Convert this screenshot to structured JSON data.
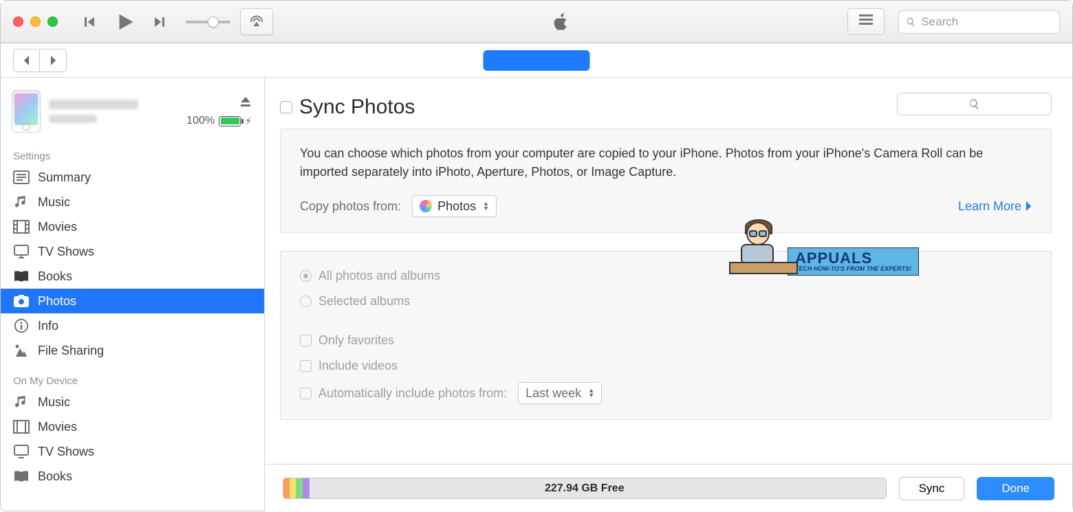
{
  "toolbar": {
    "search_placeholder": "Search"
  },
  "device": {
    "battery_percent": "100%"
  },
  "sidebar": {
    "settings_label": "Settings",
    "on_device_label": "On My Device",
    "settings_items": [
      {
        "label": "Summary"
      },
      {
        "label": "Music"
      },
      {
        "label": "Movies"
      },
      {
        "label": "TV Shows"
      },
      {
        "label": "Books"
      },
      {
        "label": "Photos"
      },
      {
        "label": "Info"
      },
      {
        "label": "File Sharing"
      }
    ],
    "device_items": [
      {
        "label": "Music"
      },
      {
        "label": "Movies"
      },
      {
        "label": "TV Shows"
      },
      {
        "label": "Books"
      }
    ]
  },
  "main": {
    "title": "Sync Photos",
    "description": "You can choose which photos from your computer are copied to your iPhone. Photos from your iPhone's Camera Roll can be imported separately into iPhoto, Aperture, Photos, or Image Capture.",
    "copy_from_label": "Copy photos from:",
    "copy_from_value": "Photos",
    "learn_more": "Learn More",
    "options": {
      "all": "All photos and albums",
      "selected": "Selected albums",
      "favorites": "Only favorites",
      "videos": "Include videos",
      "auto_label": "Automatically include photos from:",
      "auto_value": "Last week"
    }
  },
  "footer": {
    "free_space": "227.94 GB Free",
    "sync_label": "Sync",
    "done_label": "Done"
  },
  "watermark": {
    "brand": "APPUALS",
    "sub": "TECH HOW-TO'S FROM THE EXPERTS!"
  }
}
